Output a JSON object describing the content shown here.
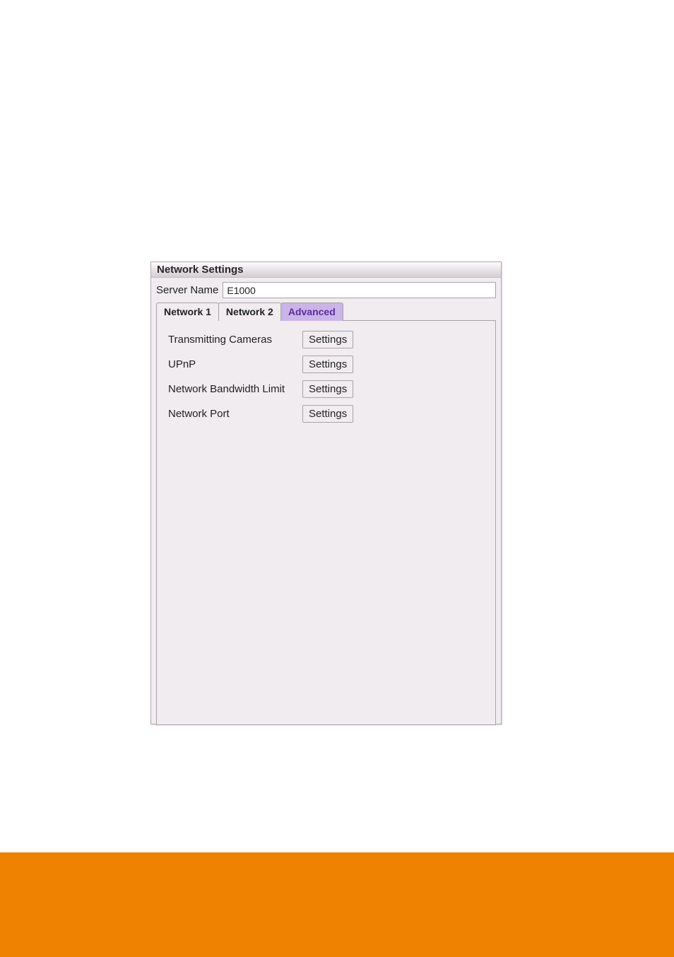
{
  "panel": {
    "title": "Network Settings",
    "server_name_label": "Server Name",
    "server_name_value": "E1000"
  },
  "tabs": [
    {
      "label": "Network 1",
      "active": false
    },
    {
      "label": "Network 2",
      "active": false
    },
    {
      "label": "Advanced",
      "active": true
    }
  ],
  "advanced_rows": [
    {
      "label": "Transmitting Cameras",
      "button": "Settings"
    },
    {
      "label": "UPnP",
      "button": "Settings"
    },
    {
      "label": "Network Bandwidth Limit",
      "button": "Settings"
    },
    {
      "label": "Network Port",
      "button": "Settings"
    }
  ],
  "colors": {
    "footer": "#ef8200",
    "active_tab_bg": "#cbb4e7",
    "active_tab_text": "#5a2ea0"
  }
}
